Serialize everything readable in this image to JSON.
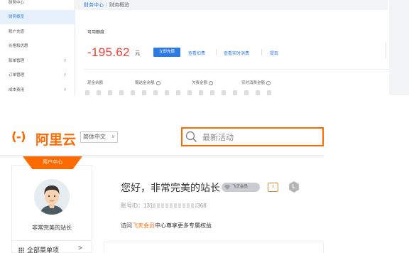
{
  "sidebar": {
    "items": [
      {
        "label": "财务中心",
        "active": false,
        "has_chevron": false
      },
      {
        "label": "财务概览",
        "active": true,
        "has_chevron": false
      },
      {
        "label": "账户充值",
        "active": false,
        "has_chevron": false
      },
      {
        "label": "价格和优惠",
        "active": false,
        "has_chevron": false
      },
      {
        "label": "账单管理",
        "active": false,
        "has_chevron": true
      },
      {
        "label": "订单管理",
        "active": false,
        "has_chevron": true
      },
      {
        "label": "成本费用",
        "active": false,
        "has_chevron": true
      }
    ],
    "chevron_glyph": "∨"
  },
  "breadcrumb": {
    "root": "财务中心",
    "separator": "/",
    "current": "财务概览"
  },
  "overview": {
    "available_label": "可用额度",
    "balance": "-195.62",
    "currency_unit": "元",
    "recharge_button": "立即充值",
    "links": [
      "查看扣费",
      "查看实时消费",
      "提现"
    ],
    "stats": [
      "现金余额",
      "赠送金余额",
      "欠费金额",
      "实时消费金额"
    ],
    "info_glyph": "i"
  },
  "portal": {
    "logo_mark": "(-)",
    "logo_text": "阿里云",
    "language": "简体中文",
    "search_placeholder": "最新活动",
    "user_center_tag": "用户中心",
    "username": "非常完美的站长",
    "all_menu": "全部菜单项",
    "all_menu_chevron": ">",
    "greeting": "您好，非常完美的站长",
    "vip_badge": "飞天会员",
    "id_badge": "≡",
    "level_badge": "L",
    "account_prefix": "账号ID：",
    "account_visible_start": "131",
    "account_visible_end": "368",
    "promo_prefix": "访问",
    "promo_highlight": "飞天会员",
    "promo_suffix": "中心尊享更多专属权益"
  },
  "colors": {
    "brand_orange": "#ff6a00",
    "link_blue": "#2c7be5",
    "balance_red": "#f04134"
  }
}
